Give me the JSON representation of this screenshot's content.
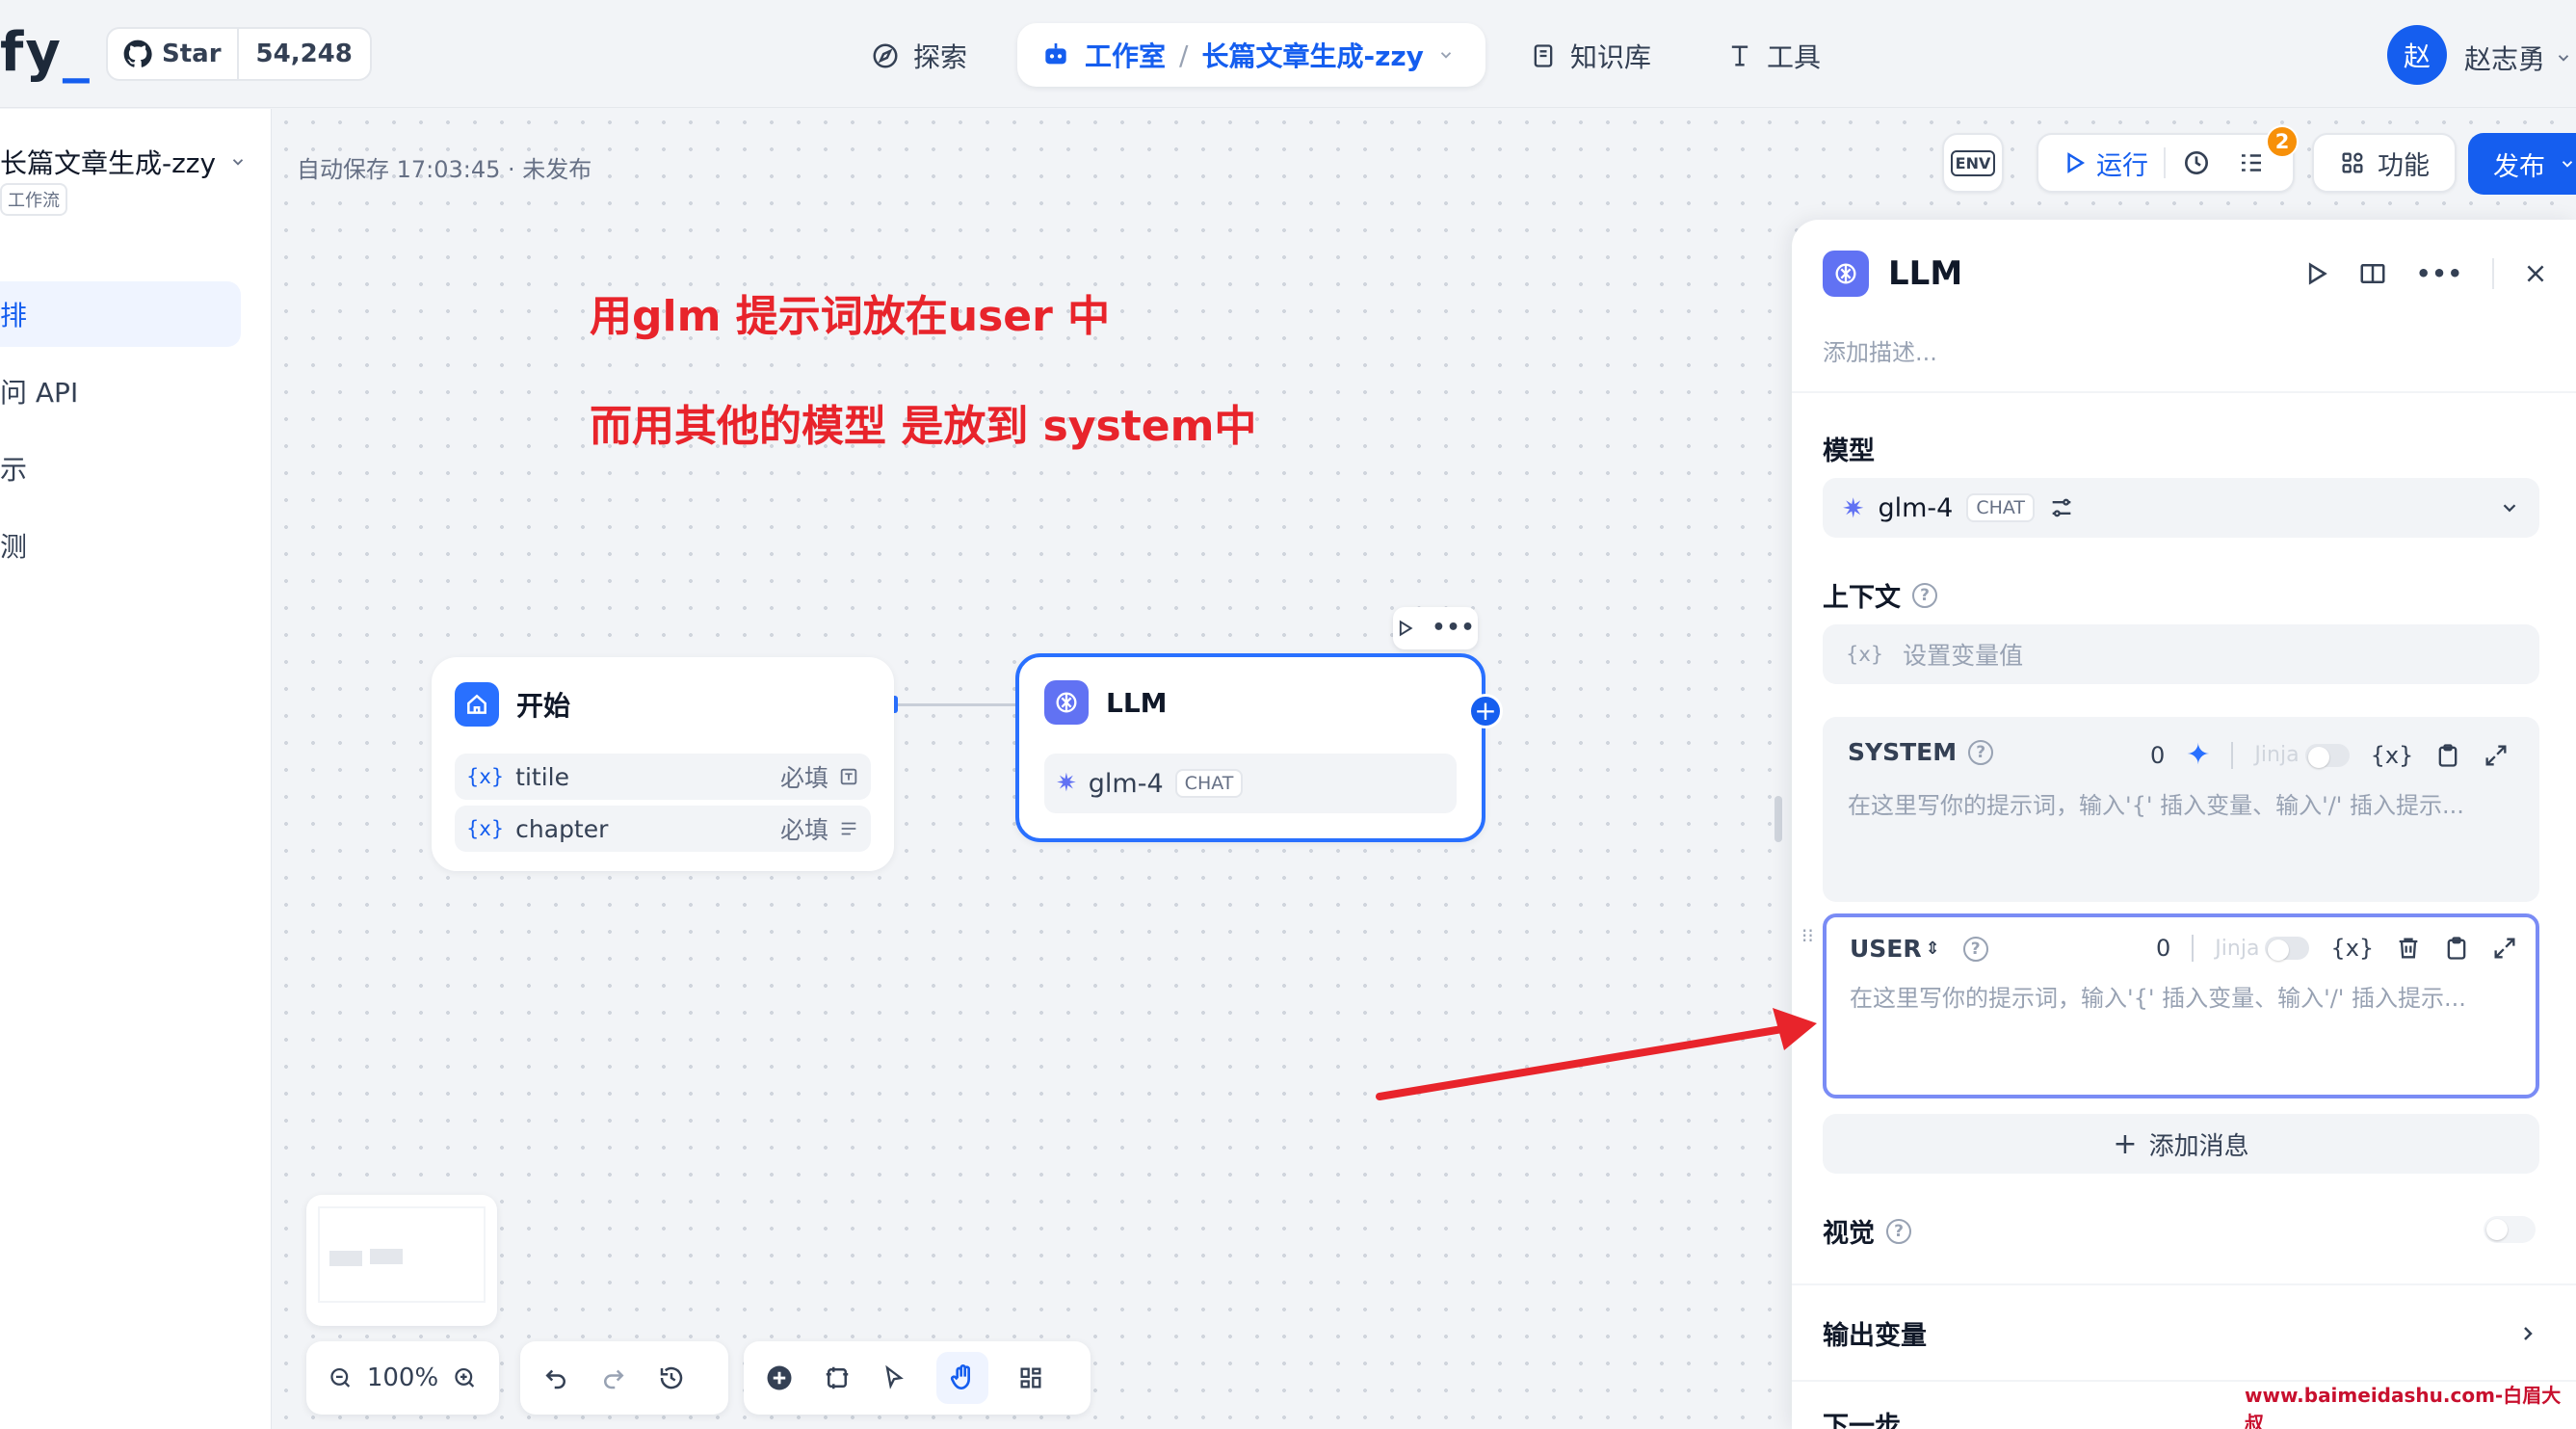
{
  "header": {
    "logo_text": "fy",
    "star_label": "Star",
    "star_count": "54,248",
    "nav_explore": "探索",
    "nav_studio": "工作室",
    "app_name": "长篇文章生成-zzy",
    "nav_knowledge": "知识库",
    "nav_tools": "工具",
    "avatar_initial": "赵",
    "user_name": "赵志勇"
  },
  "sidebar": {
    "app_title": "长篇文章生成-zzy",
    "app_type": "工作流",
    "items": [
      {
        "label": "排"
      },
      {
        "label": "问 API"
      },
      {
        "label": "示"
      },
      {
        "label": "测"
      }
    ]
  },
  "canvas": {
    "autosave": "自动保存 17:03:45 · 未发布",
    "annotation_1": "用glm 提示词放在user 中",
    "annotation_2": "而用其他的模型 是放到 system中",
    "zoom": "100%"
  },
  "toolbar": {
    "env": "ENV",
    "run": "运行",
    "badge_count": "2",
    "features": "功能",
    "publish": "发布"
  },
  "start_node": {
    "title": "开始",
    "vars": [
      {
        "name": "titile",
        "req": "必填"
      },
      {
        "name": "chapter",
        "req": "必填"
      }
    ]
  },
  "llm_node": {
    "title": "LLM",
    "model": "glm-4",
    "mode": "CHAT"
  },
  "panel": {
    "title": "LLM",
    "desc_placeholder": "添加描述...",
    "model_label": "模型",
    "model_name": "glm-4",
    "model_mode": "CHAT",
    "context_label": "上下文",
    "context_placeholder": "设置变量值",
    "system_label": "SYSTEM",
    "system_count": "0",
    "jinja": "Jinja",
    "var_icon": "{x}",
    "prompt_placeholder": "在这里写你的提示词，输入'{' 插入变量、输入'/' 插入提示...",
    "user_label": "USER",
    "user_count": "0",
    "add_message": "添加消息",
    "vision_label": "视觉",
    "output_label": "输出变量",
    "bottom_cut": "下一步"
  },
  "watermark": "www.baimeidashu.com-白眉大叔"
}
